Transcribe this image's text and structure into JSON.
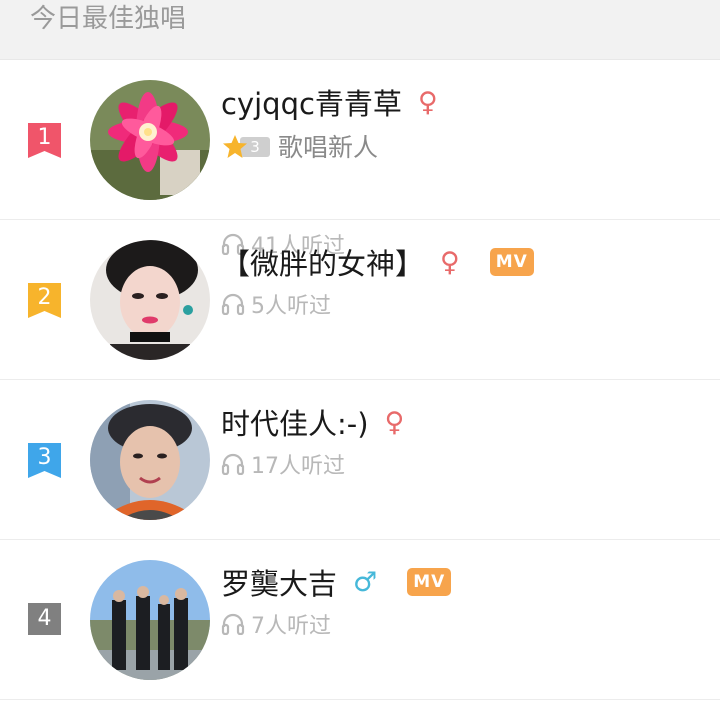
{
  "header": {
    "title": "今日最佳独唱"
  },
  "entries": [
    {
      "rank": "1",
      "rank_color": "#f0556a",
      "name": "cyjqqc青青草",
      "gender": "♀",
      "level": "3",
      "level_title": "歌唱新人",
      "listens": "41人听过",
      "mv": ""
    },
    {
      "rank": "2",
      "rank_color": "#f7b42c",
      "name": "【微胖的女神】",
      "gender": "♀",
      "listens": "5人听过",
      "mv": "MV"
    },
    {
      "rank": "3",
      "rank_color": "#3fa6ea",
      "name": "时代佳人:-)",
      "gender": "♀",
      "listens": "17人听过",
      "mv": ""
    },
    {
      "rank": "4",
      "rank_color": "#808080",
      "name": "罗龑大吉",
      "gender": "♂",
      "listens": "7人听过",
      "mv": "MV"
    }
  ]
}
